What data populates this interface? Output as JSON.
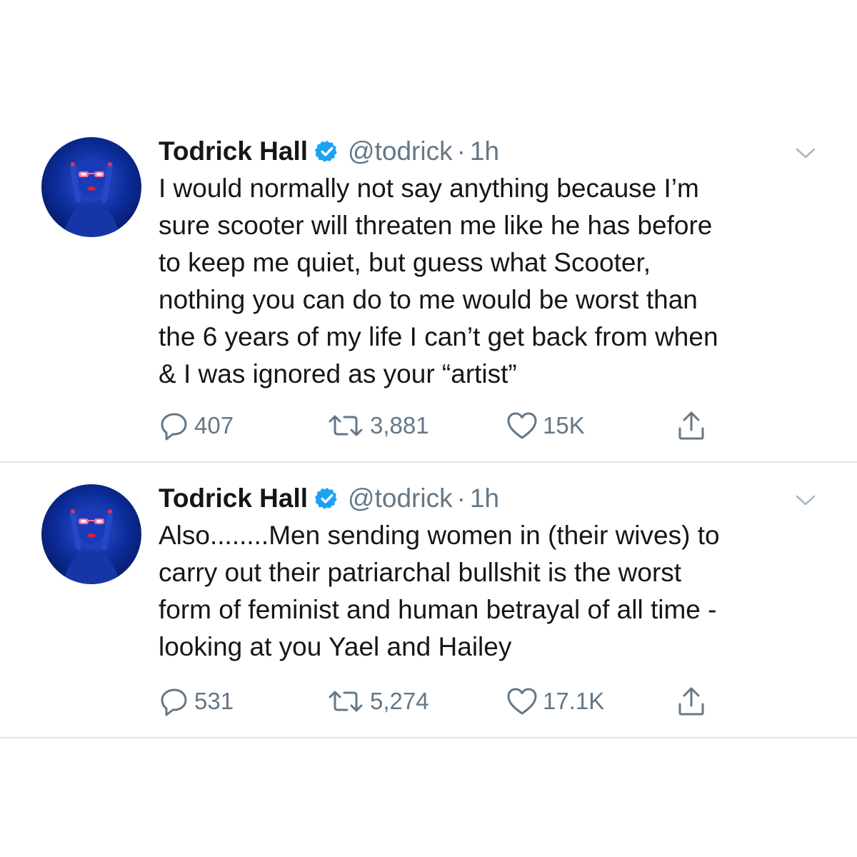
{
  "colors": {
    "text": "#14171a",
    "secondary": "#657786",
    "verified": "#1da1f2",
    "divider": "#e1e8ed",
    "avatar_bg": "#0a2a8c"
  },
  "tweets": [
    {
      "display_name": "Todrick Hall",
      "verified": true,
      "handle": "@todrick",
      "separator": "·",
      "time": "1h",
      "text": "I would normally not say anything because I’m\nsure scooter will threaten me like he has before\nto keep me quiet, but guess what Scooter,\nnothing you can do to me would be worst than\nthe 6 years of my life I can’t get back from when\n& I was ignored as your “artist”",
      "replies": "407",
      "retweets": "3,881",
      "likes": "15K",
      "icons": [
        "reply-icon",
        "retweet-icon",
        "like-icon",
        "share-icon",
        "chevron-down-icon",
        "verified-badge-icon"
      ]
    },
    {
      "display_name": "Todrick Hall",
      "verified": true,
      "handle": "@todrick",
      "separator": "·",
      "time": "1h",
      "text": "Also........Men sending women in (their wives) to\ncarry out their patriarchal bullshit is the worst\nform of feminist and human betrayal of all time -\nlooking at you Yael and Hailey",
      "replies": "531",
      "retweets": "5,274",
      "likes": "17.1K",
      "icons": [
        "reply-icon",
        "retweet-icon",
        "like-icon",
        "share-icon",
        "chevron-down-icon",
        "verified-badge-icon"
      ]
    }
  ]
}
